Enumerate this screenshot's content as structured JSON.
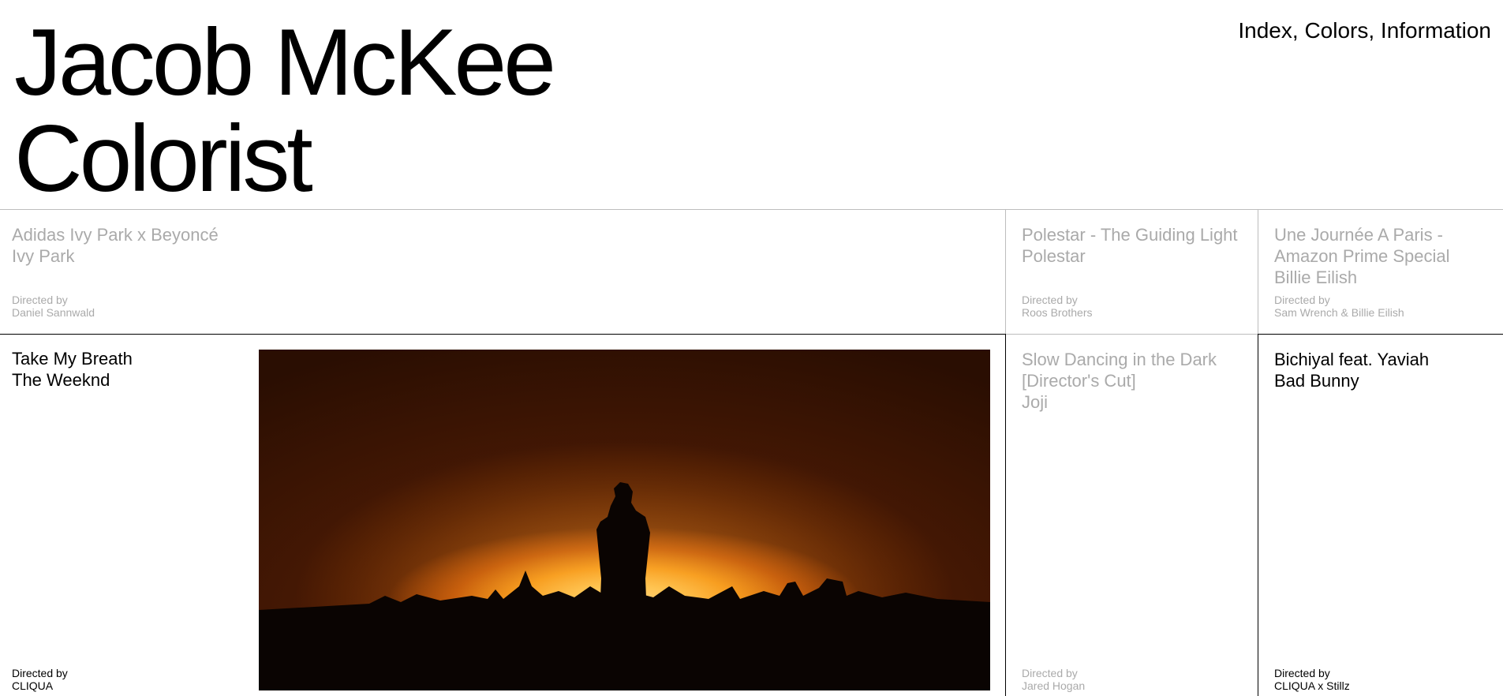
{
  "header": {
    "title_line1": "Jacob McKee",
    "title_line2": "Colorist",
    "nav": {
      "index": "Index",
      "colors": "Colors",
      "information": "Information",
      "separator": ", "
    }
  },
  "projects": [
    {
      "title": "Adidas Ivy Park x Beyoncé",
      "artist": "Ivy Park",
      "directed_label": "Directed by",
      "director": "Daniel Sannwald"
    },
    {
      "title": "Polestar - The Guiding Light",
      "artist": "Polestar",
      "directed_label": "Directed by",
      "director": "Roos Brothers"
    },
    {
      "title_line1": "Une Journée A Paris -",
      "title_line2": "Amazon Prime Special",
      "artist": "Billie Eilish",
      "directed_label": "Directed by",
      "director": "Sam Wrench & Billie Eilish"
    },
    {
      "title": "Take My Breath",
      "artist": "The Weeknd",
      "directed_label": "Directed by",
      "director": "CLIQUA"
    },
    {
      "title_line1": "Slow Dancing in the Dark",
      "title_line2": "[Director's Cut]",
      "artist": "Joji",
      "directed_label": "Directed by",
      "director": "Jared Hogan"
    },
    {
      "title": "Bichiyal feat. Yaviah",
      "artist": "Bad Bunny",
      "directed_label": "Directed by",
      "director": "CLIQUA x Stillz"
    }
  ],
  "colors": {
    "text": "#000000",
    "muted": "#aaaaaa",
    "rule_light": "#bdbdbd",
    "rule_dark": "#000000",
    "background": "#ffffff"
  }
}
